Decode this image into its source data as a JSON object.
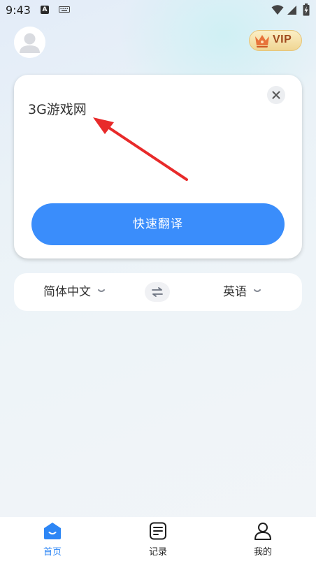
{
  "status_bar": {
    "time": "9:43",
    "icons": [
      "a-notification-icon",
      "keyboard-icon",
      "wifi-icon",
      "signal-icon",
      "battery-icon"
    ],
    "a_glyph": "A"
  },
  "header": {
    "avatar_icon": "user-avatar-icon",
    "vip_label": "VIP",
    "vip_icon": "crown-icon"
  },
  "input_card": {
    "text": "3G游戏网",
    "clear_icon": "close-icon",
    "translate_button_label": "快速翻译"
  },
  "language_bar": {
    "source_language": "简体中文",
    "target_language": "英语",
    "swap_icon": "swap-arrows-icon"
  },
  "bottom_nav": {
    "items": [
      {
        "label": "首页",
        "icon": "home-icon",
        "active": true
      },
      {
        "label": "记录",
        "icon": "records-icon",
        "active": false
      },
      {
        "label": "我的",
        "icon": "profile-icon",
        "active": false
      }
    ]
  },
  "colors": {
    "accent": "#3a8dfb",
    "nav_active": "#2d86f5",
    "vip_text": "#a04a1d",
    "vip_gold": "#f0d693",
    "annotation_arrow": "#e82a2a"
  }
}
